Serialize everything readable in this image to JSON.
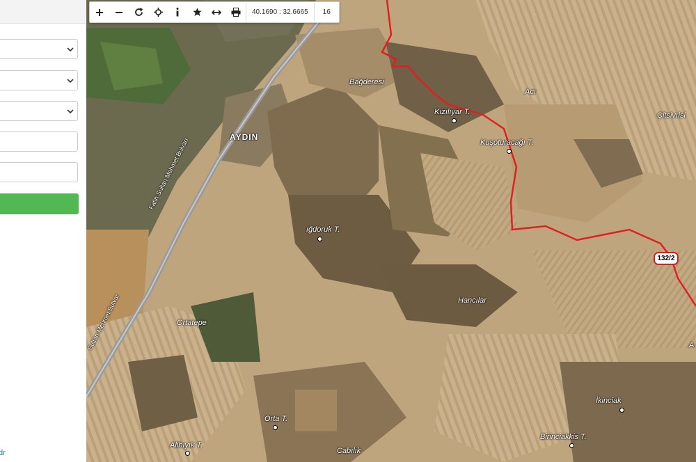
{
  "panel": {
    "selects": [
      "",
      "",
      ""
    ],
    "inputs": [
      "",
      ""
    ],
    "action_button": "",
    "footer_link": "dr"
  },
  "toolbar": {
    "tools": [
      "zoom-in",
      "zoom-out",
      "refresh",
      "locate",
      "info",
      "favorite",
      "measure",
      "print"
    ],
    "coordinates": "40.1690 : 32.6665",
    "zoom_level": "16"
  },
  "map": {
    "labels": {
      "bagderesi": "Bağderesi",
      "aci": "Acı",
      "kiziliyar": "Kızılıyar T.",
      "citsivrisi": "Çitsivrisi",
      "kusoturacagi": "Kuşoturacağı T.",
      "aydin": "AYDIN",
      "road1": "Fatih Sultan Mehmet Bulvarı",
      "road2": "Sultan Mehmet Bulvar",
      "dagdoruk": "ığdoruk T.",
      "hancilar": "Hancılar",
      "ortatepe": "Ortatepe",
      "orta": "Orta T.",
      "alibiyik": "Alibıyık T.",
      "cabilik": "Cabılık",
      "ikinciak": "İkinciak",
      "birinciakkis": "Birinciakkis T.",
      "edge_a": "A"
    },
    "parcel_label": "132/2",
    "boundary_color": "#e02020"
  }
}
